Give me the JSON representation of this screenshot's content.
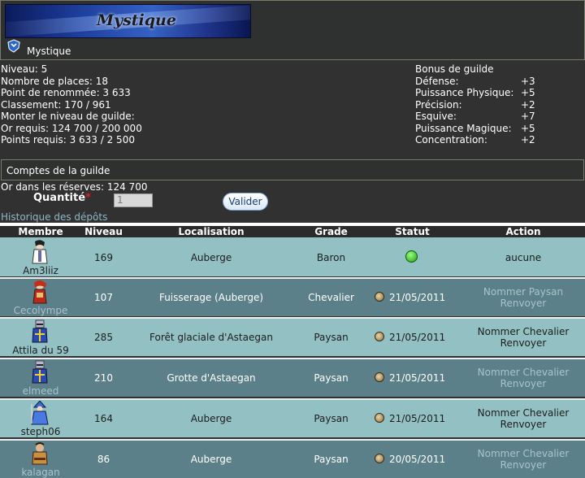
{
  "guild": {
    "banner_text": "Mystique",
    "name": "Mystique"
  },
  "info": {
    "niveau": "Niveau: 5",
    "places": "Nombre de places: 18",
    "renommee": "Point de renommée: 3 633",
    "classement": "Classement: 170 / 961",
    "monter": "Monter le niveau de guilde:",
    "or_requis": "Or requis: 124 700 / 200 000",
    "points_requis": "Points requis: 3 633 / 2 500"
  },
  "bonus": {
    "title": "Bonus de guilde",
    "items": [
      {
        "label": "Défense:",
        "value": "+3"
      },
      {
        "label": "Puissance Physique:",
        "value": "+5"
      },
      {
        "label": "Précision:",
        "value": "+2"
      },
      {
        "label": "Esquive:",
        "value": "+7"
      },
      {
        "label": "Puissance Magique:",
        "value": "+5"
      },
      {
        "label": "Concentration:",
        "value": "+2"
      }
    ]
  },
  "comptes": {
    "title": "Comptes de la guilde",
    "or_reserves": "Or dans les réserves: 124 700",
    "quantite_label": "Quantité",
    "required_mark": "*",
    "quantite_value": "1",
    "valider": "Valider",
    "historique": "Historique des dépôts"
  },
  "table": {
    "headers": [
      "Membre",
      "Niveau",
      "Localisation",
      "Grade",
      "Statut",
      "Action"
    ],
    "rows": [
      {
        "membre": "Am3liiz",
        "niveau": "169",
        "localisation": "Auberge",
        "grade": "Baron",
        "statut": "",
        "action1": "aucune",
        "action2": ""
      },
      {
        "membre": "Cecolympe",
        "niveau": "107",
        "localisation": "Fuisserage (Auberge)",
        "grade": "Chevalier",
        "statut": "21/05/2011",
        "action1": "Nommer Paysan",
        "action2": "Renvoyer"
      },
      {
        "membre": "Attila du 59",
        "niveau": "285",
        "localisation": "Forêt glaciale d'Astaegan",
        "grade": "Paysan",
        "statut": "21/05/2011",
        "action1": "Nommer Chevalier",
        "action2": "Renvoyer"
      },
      {
        "membre": "elmeed",
        "niveau": "210",
        "localisation": "Grotte d'Astaegan",
        "grade": "Paysan",
        "statut": "21/05/2011",
        "action1": "Nommer Chevalier",
        "action2": "Renvoyer"
      },
      {
        "membre": "steph06",
        "niveau": "164",
        "localisation": "Auberge",
        "grade": "Paysan",
        "statut": "21/05/2011",
        "action1": "Nommer Chevalier",
        "action2": "Renvoyer"
      },
      {
        "membre": "kalagan",
        "niveau": "86",
        "localisation": "Auberge",
        "grade": "Paysan",
        "statut": "20/05/2011",
        "action1": "Nommer Chevalier",
        "action2": "Renvoyer"
      }
    ]
  }
}
